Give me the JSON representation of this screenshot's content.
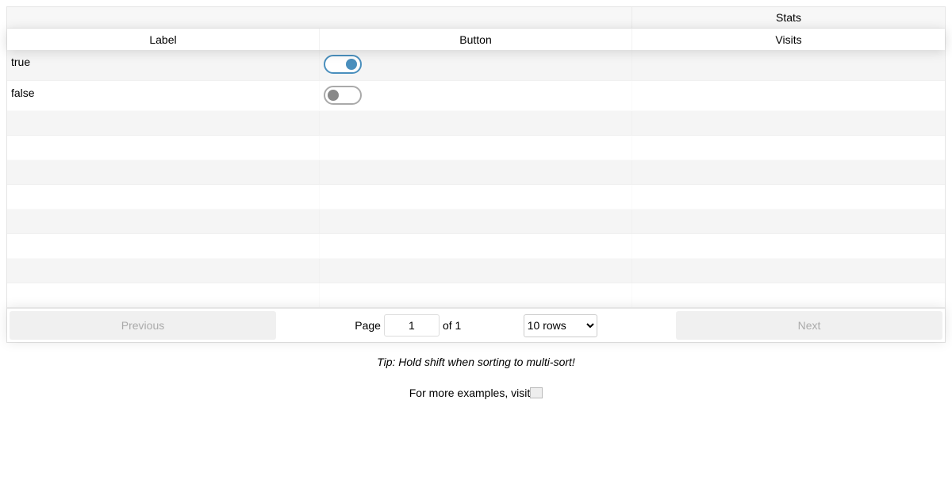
{
  "table": {
    "group_headers": [
      "",
      "Stats"
    ],
    "columns": [
      "Label",
      "Button",
      "Visits"
    ],
    "rows": [
      {
        "label": "true",
        "toggle_on": true,
        "visits": ""
      },
      {
        "label": "false",
        "toggle_on": false,
        "visits": ""
      }
    ],
    "empty_rows": 8
  },
  "pagination": {
    "previous_label": "Previous",
    "next_label": "Next",
    "page_label": "Page",
    "page_value": "1",
    "of_label": "of 1",
    "rows_option": "10 rows"
  },
  "tip": "Tip: Hold shift when sorting to multi-sort!",
  "more_text": "For more examples, visit",
  "colors": {
    "toggle_on": "#4a8fbd",
    "toggle_off": "#888888"
  }
}
